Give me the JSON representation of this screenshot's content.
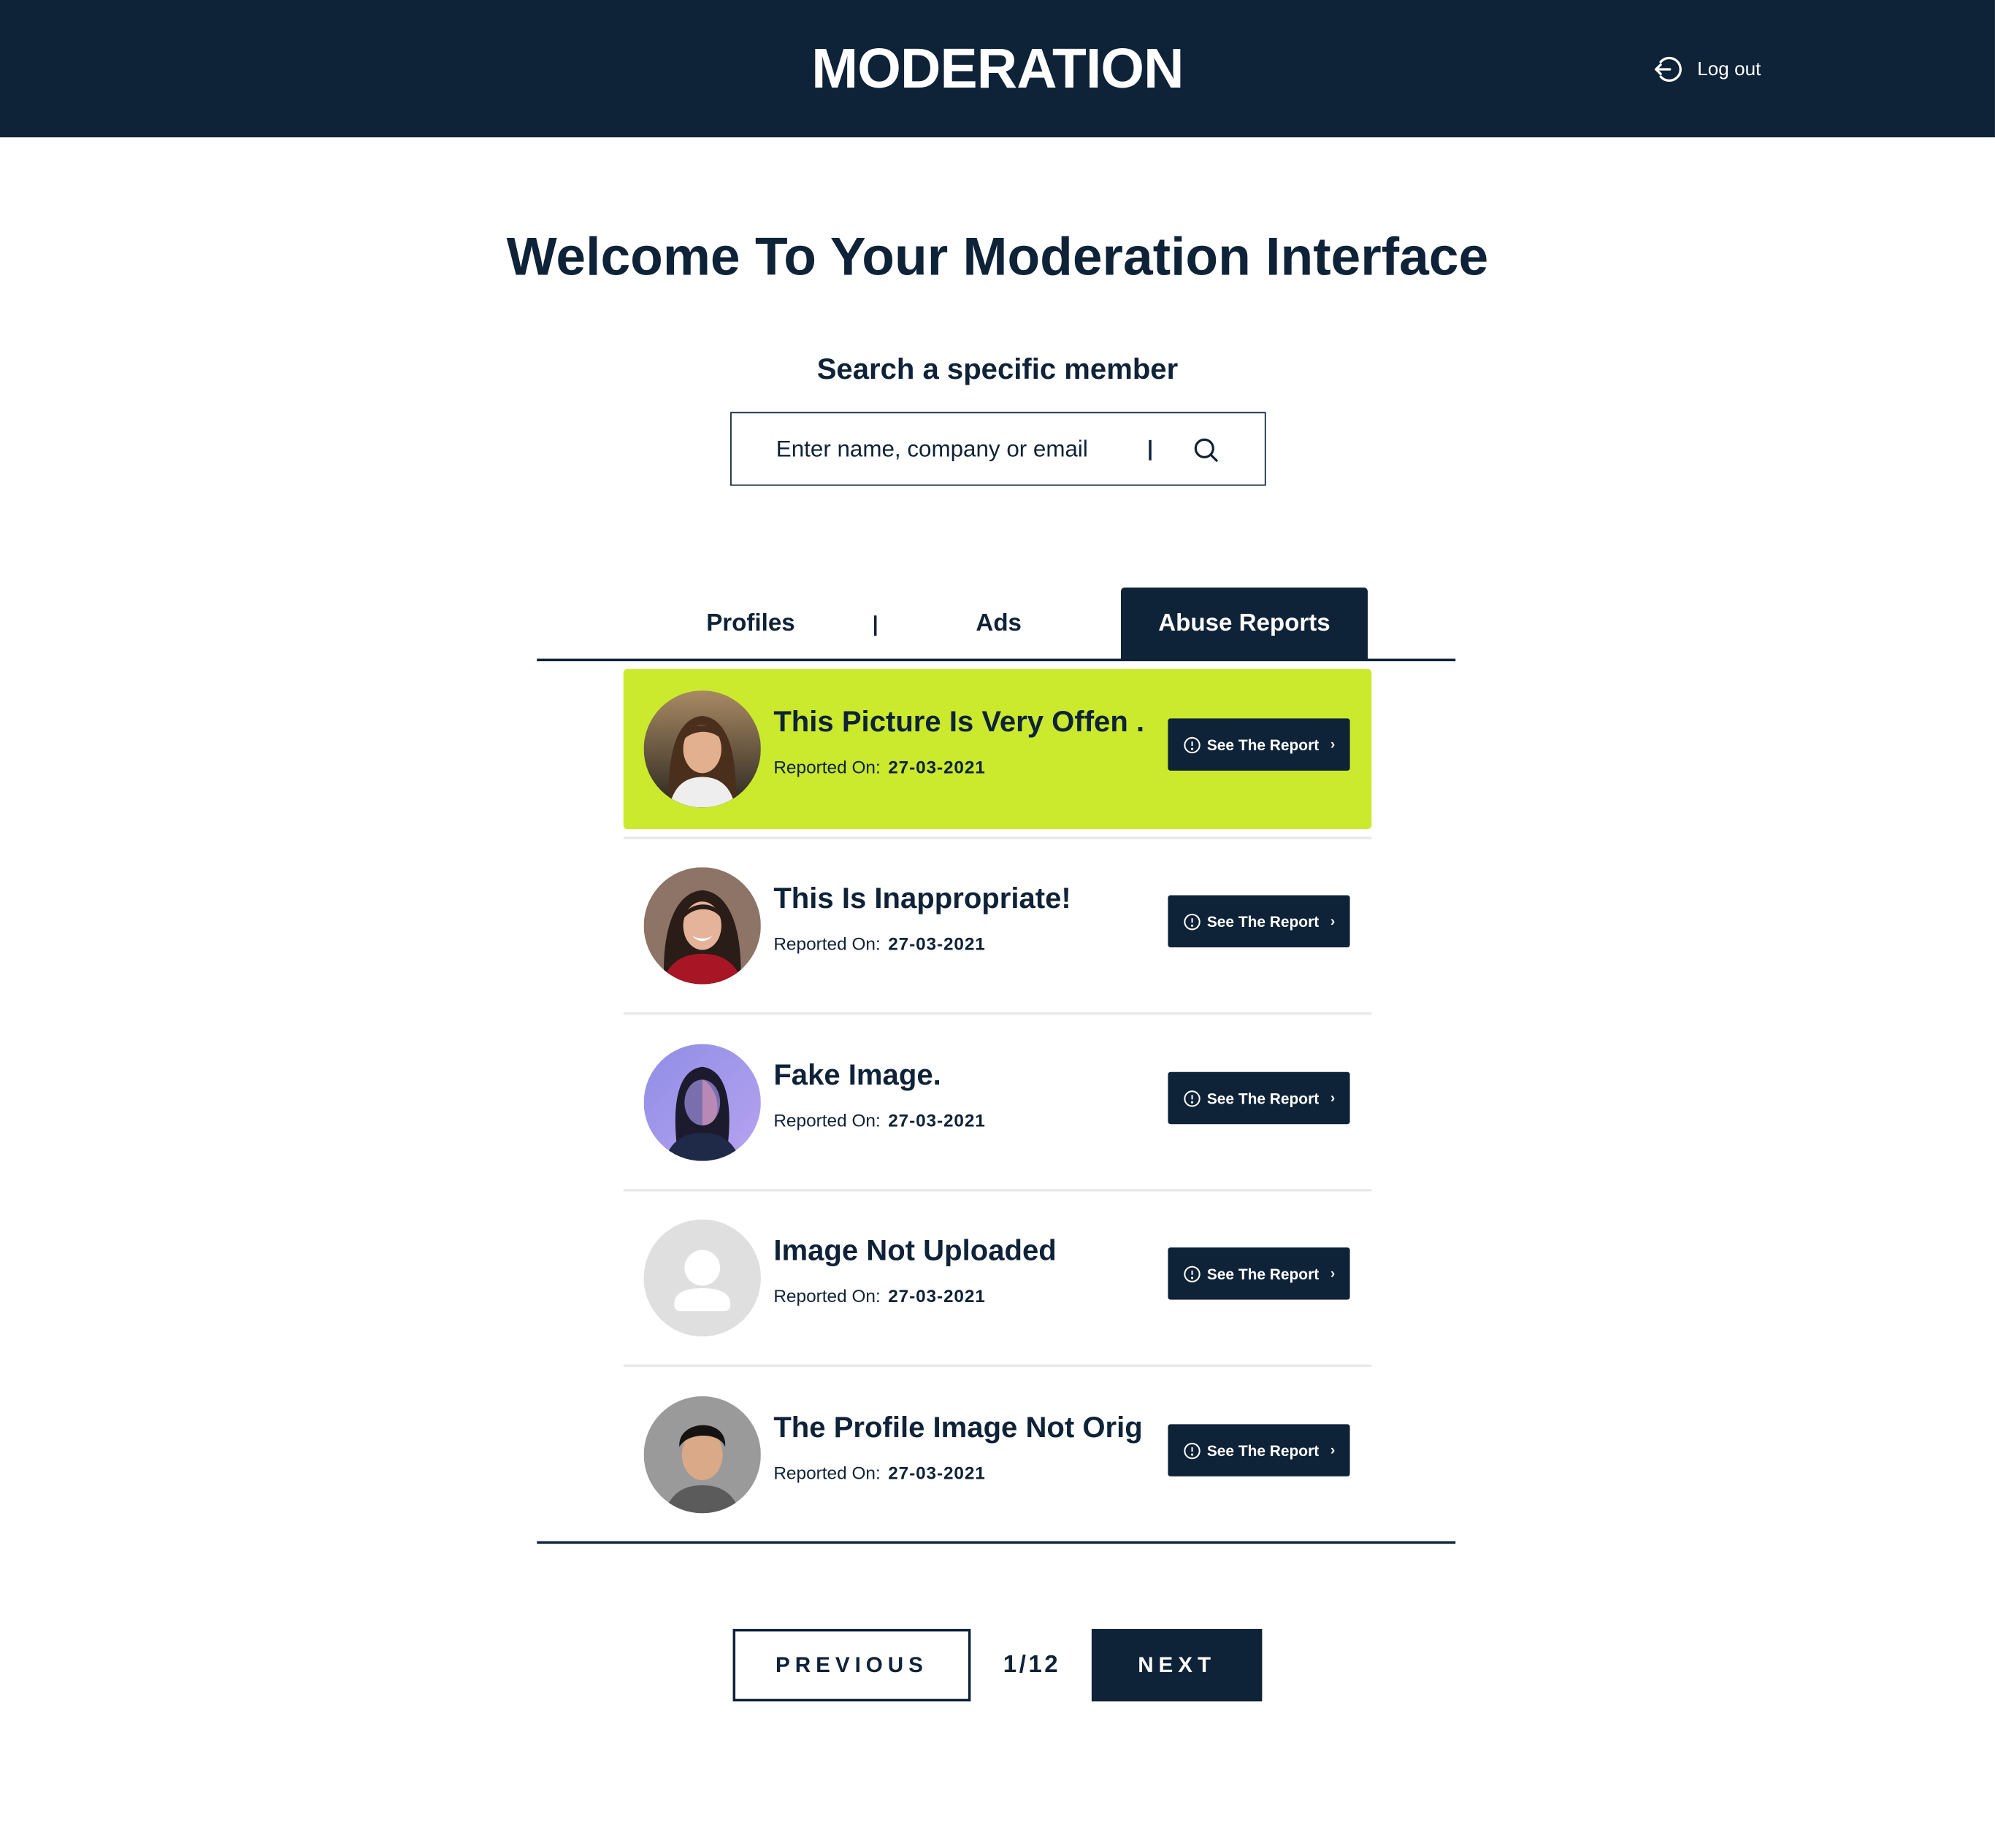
{
  "header": {
    "brand": "MODERATION",
    "logout_label": "Log out",
    "background": "#0e2238"
  },
  "welcome": {
    "title": "Welcome To Your Moderation Interface"
  },
  "search": {
    "title": "Search a specific member",
    "placeholder": "Enter name, company or email"
  },
  "tabs": [
    {
      "label": "Profiles",
      "active": false
    },
    {
      "label": "Ads",
      "active": false
    },
    {
      "label": "Abuse Reports",
      "active": true
    }
  ],
  "reports": [
    {
      "title": "This Picture Is Very Offen ...",
      "date_label": "Reported On:",
      "date": "27-03-2021",
      "button": "See The Report",
      "avatar": "woman-brown-hair-photo",
      "highlighted": true
    },
    {
      "title": "This Is Inappropriate!",
      "date_label": "Reported On:",
      "date": "27-03-2021",
      "button": "See The Report",
      "avatar": "woman-smiling-red-top-photo",
      "highlighted": false
    },
    {
      "title": "Fake Image.",
      "date_label": "Reported On:",
      "date": "27-03-2021",
      "button": "See The Report",
      "avatar": "woman-purple-light-photo",
      "highlighted": false
    },
    {
      "title": "Image Not Uploaded",
      "date_label": "Reported On:",
      "date": "27-03-2021",
      "button": "See The Report",
      "avatar": "user-placeholder-icon",
      "highlighted": false
    },
    {
      "title": "The Profile Image Not Orig...",
      "date_label": "Reported On:",
      "date": "27-03-2021",
      "button": "See The Report",
      "avatar": "man-dark-hair-photo",
      "highlighted": false
    }
  ],
  "pagination": {
    "previous": "PREVIOUS",
    "count": "1/12",
    "next": "NEXT"
  },
  "colors": {
    "navy": "#0e2238",
    "highlight": "#cbe92d",
    "divider": "#e9e9e9"
  }
}
